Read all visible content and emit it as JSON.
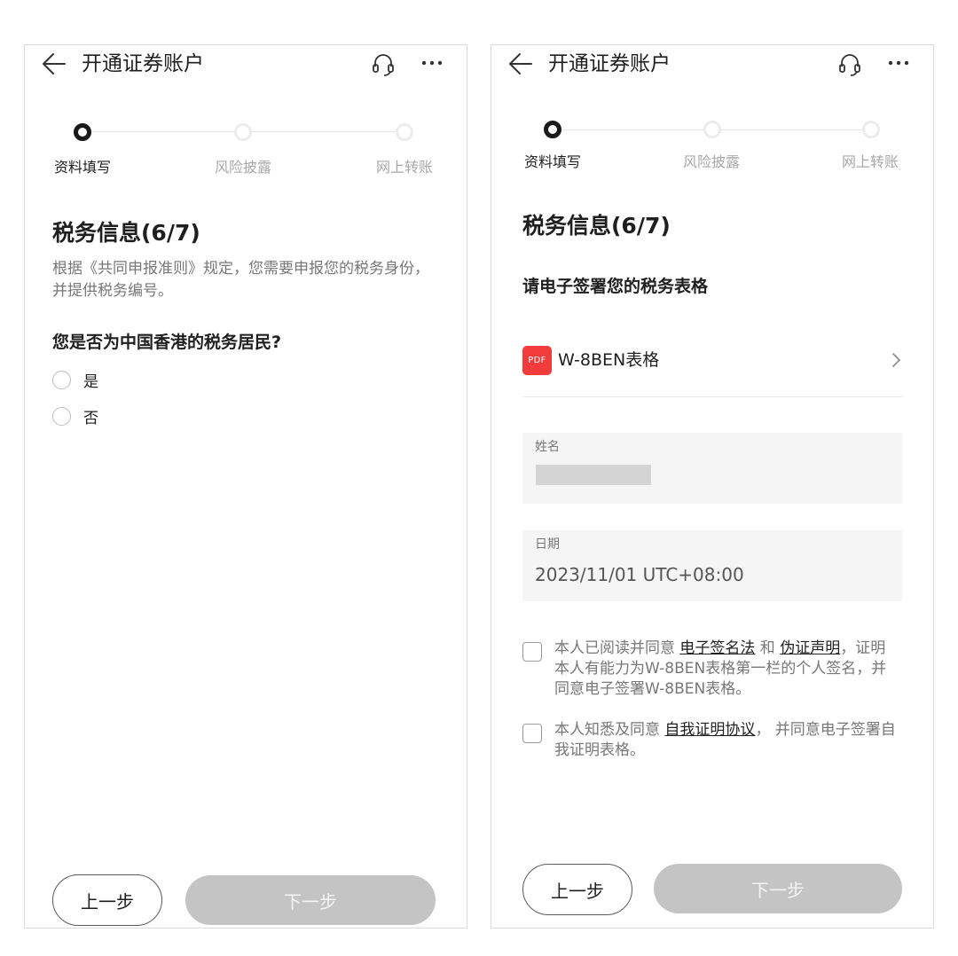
{
  "header": {
    "title": "开通证券账户"
  },
  "steps": [
    {
      "label": "资料填写",
      "state": "active"
    },
    {
      "label": "风险披露",
      "state": "inactive"
    },
    {
      "label": "网上转账",
      "state": "inactive"
    }
  ],
  "left": {
    "section_title": "税务信息(6/7)",
    "description": "根据《共同申报准则》规定，您需要申报您的税务身份，并提供税务编号。",
    "question": "您是否为中国香港的税务居民?",
    "options": [
      "是",
      "否"
    ]
  },
  "right": {
    "section_title": "税务信息(6/7)",
    "sub_title": "请电子签署您的税务表格",
    "pdf_badge": "PDF",
    "pdf_name": "W-8BEN表格",
    "name_label": "姓名",
    "date_label": "日期",
    "date_value": "2023/11/01 UTC+08:00",
    "agree1": {
      "pre": "本人已阅读并同意 ",
      "link1": "电子签名法",
      "mid": " 和 ",
      "link2": "伪证声明",
      "post": "，证明本人有能力为W-8BEN表格第一栏的个人签名，并同意电子签署W-8BEN表格。"
    },
    "agree2": {
      "pre": "本人知悉及同意 ",
      "link": "自我证明协议",
      "post": "， 并同意电子签署自我证明表格。"
    }
  },
  "buttons": {
    "prev": "上一步",
    "next": "下一步"
  },
  "colors": {
    "pdf_badge": "#f23b3b",
    "next_disabled": "#c4c4c4",
    "active_step": "#1a1a1a"
  }
}
